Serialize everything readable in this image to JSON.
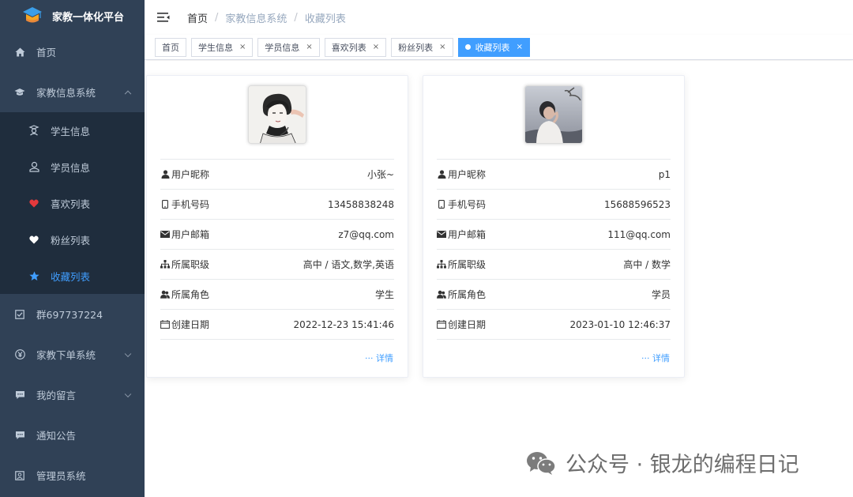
{
  "app": {
    "title": "家教一体化平台"
  },
  "sidebar": {
    "items": [
      {
        "label": "首页",
        "icon": "home-icon"
      },
      {
        "label": "家教信息系统",
        "icon": "graduation-cap-icon"
      },
      {
        "label": "群697737224",
        "icon": "checkbox-icon"
      },
      {
        "label": "家教下单系统",
        "icon": "yen-icon"
      },
      {
        "label": "我的留言",
        "icon": "message-icon"
      },
      {
        "label": "通知公告",
        "icon": "notice-icon"
      },
      {
        "label": "管理员系统",
        "icon": "admin-icon"
      }
    ],
    "submenu": [
      {
        "label": "学生信息",
        "icon": "student-icon"
      },
      {
        "label": "学员信息",
        "icon": "user-outline-icon"
      },
      {
        "label": "喜欢列表",
        "icon": "heart-icon",
        "color": "#e4393c"
      },
      {
        "label": "粉丝列表",
        "icon": "heart-icon",
        "color": "#ffffff"
      },
      {
        "label": "收藏列表",
        "icon": "star-icon",
        "color": "#409eff"
      }
    ]
  },
  "breadcrumb": [
    "首页",
    "家教信息系统",
    "收藏列表"
  ],
  "tags": [
    {
      "label": "首页"
    },
    {
      "label": "学生信息"
    },
    {
      "label": "学员信息"
    },
    {
      "label": "喜欢列表"
    },
    {
      "label": "粉丝列表"
    },
    {
      "label": "收藏列表"
    }
  ],
  "labels": {
    "nickname": "用户昵称",
    "phone": "手机号码",
    "email": "用户邮箱",
    "level": "所属职级",
    "role": "所属角色",
    "created": "创建日期",
    "detail": "详情"
  },
  "cards": [
    {
      "nickname": "小张~",
      "phone": "13458838248",
      "email": "z7@qq.com",
      "level": "高中 / 语文,数学,英语",
      "role": "学生",
      "created": "2022-12-23 15:41:46"
    },
    {
      "nickname": "p1",
      "phone": "15688596523",
      "email": "111@qq.com",
      "level": "高中 / 数学",
      "role": "学员",
      "created": "2023-01-10 12:46:37"
    }
  ],
  "watermark": {
    "text": "公众号 · 银龙的编程日记"
  },
  "colors": {
    "sidebar_bg": "#304156",
    "submenu_bg": "#1f2d3d",
    "accent": "#409eff"
  }
}
